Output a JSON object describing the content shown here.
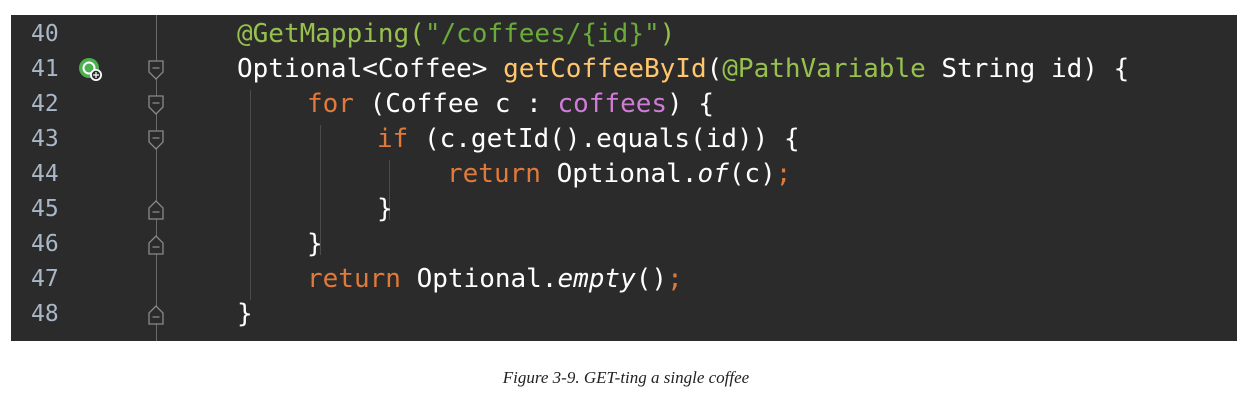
{
  "editor": {
    "lines": [
      {
        "number": "40",
        "tokens": [
          "@GetMapping(",
          "\"/coffees/{id}\"",
          ")"
        ]
      },
      {
        "number": "41",
        "tokens": [
          "Optional<Coffee> ",
          "getCoffeeById",
          "(",
          "@PathVariable",
          " String id) {"
        ]
      },
      {
        "number": "42",
        "tokens": [
          "for",
          " (Coffee c : ",
          "coffees",
          ") {"
        ]
      },
      {
        "number": "43",
        "tokens": [
          "if",
          " (c.getId().equals(id)) {"
        ]
      },
      {
        "number": "44",
        "tokens": [
          "return",
          " Optional.",
          "of",
          "(c)",
          ";"
        ]
      },
      {
        "number": "45",
        "tokens": [
          "}"
        ]
      },
      {
        "number": "46",
        "tokens": [
          "}"
        ]
      },
      {
        "number": "47",
        "tokens": [
          "return",
          " Optional.",
          "empty",
          "()",
          ";"
        ]
      },
      {
        "number": "48",
        "tokens": [
          "}"
        ]
      }
    ],
    "gutter_icons": {
      "run_icon": "spring-web-endpoint-icon",
      "fold_icons": [
        "fold-start-icon",
        "fold-end-icon"
      ]
    },
    "colors": {
      "background": "#2b2b2b",
      "annotation": "#97c14e",
      "string": "#6aab3a",
      "method": "#ffc66d",
      "keyword": "#e07a3b",
      "field": "#d17bd8"
    }
  },
  "caption": "Figure 3-9. GET-ting a single coffee"
}
